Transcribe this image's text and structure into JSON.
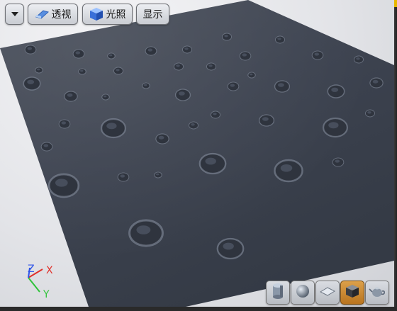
{
  "toolbar": {
    "dropdown_icon": "chevron-down-icon",
    "perspective_label": "透视",
    "perspective_icon": "perspective-icon",
    "lighting_label": "光照",
    "lighting_icon": "lit-cube-icon",
    "show_label": "显示"
  },
  "axis_gizmo": {
    "z_label": "Z",
    "x_label": "X",
    "y_label": "Y",
    "colors": {
      "x": "#e0302a",
      "y": "#2fc23a",
      "z": "#2e54e8"
    }
  },
  "preview_modes": [
    {
      "name": "cylinder",
      "icon": "cylinder-icon",
      "active": false
    },
    {
      "name": "sphere",
      "icon": "sphere-icon",
      "active": false
    },
    {
      "name": "plane",
      "icon": "plane-icon",
      "active": false
    },
    {
      "name": "cube",
      "icon": "cube-icon",
      "active": true
    },
    {
      "name": "custom-mesh",
      "icon": "teapot-icon",
      "active": false
    }
  ],
  "colors": {
    "accent": "#e8b800",
    "surface": "#3d4350",
    "background": "#e3e4e8",
    "active_mode": "#c8862e"
  }
}
